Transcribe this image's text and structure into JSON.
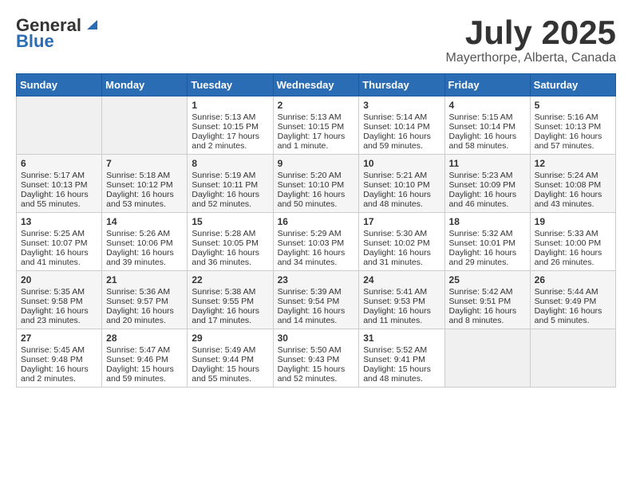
{
  "logo": {
    "general": "General",
    "blue": "Blue"
  },
  "title": "July 2025",
  "location": "Mayerthorpe, Alberta, Canada",
  "weekdays": [
    "Sunday",
    "Monday",
    "Tuesday",
    "Wednesday",
    "Thursday",
    "Friday",
    "Saturday"
  ],
  "weeks": [
    [
      {
        "day": "",
        "empty": true
      },
      {
        "day": "",
        "empty": true
      },
      {
        "day": "1",
        "sunrise": "Sunrise: 5:13 AM",
        "sunset": "Sunset: 10:15 PM",
        "daylight": "Daylight: 17 hours and 2 minutes."
      },
      {
        "day": "2",
        "sunrise": "Sunrise: 5:13 AM",
        "sunset": "Sunset: 10:15 PM",
        "daylight": "Daylight: 17 hours and 1 minute."
      },
      {
        "day": "3",
        "sunrise": "Sunrise: 5:14 AM",
        "sunset": "Sunset: 10:14 PM",
        "daylight": "Daylight: 16 hours and 59 minutes."
      },
      {
        "day": "4",
        "sunrise": "Sunrise: 5:15 AM",
        "sunset": "Sunset: 10:14 PM",
        "daylight": "Daylight: 16 hours and 58 minutes."
      },
      {
        "day": "5",
        "sunrise": "Sunrise: 5:16 AM",
        "sunset": "Sunset: 10:13 PM",
        "daylight": "Daylight: 16 hours and 57 minutes."
      }
    ],
    [
      {
        "day": "6",
        "sunrise": "Sunrise: 5:17 AM",
        "sunset": "Sunset: 10:13 PM",
        "daylight": "Daylight: 16 hours and 55 minutes."
      },
      {
        "day": "7",
        "sunrise": "Sunrise: 5:18 AM",
        "sunset": "Sunset: 10:12 PM",
        "daylight": "Daylight: 16 hours and 53 minutes."
      },
      {
        "day": "8",
        "sunrise": "Sunrise: 5:19 AM",
        "sunset": "Sunset: 10:11 PM",
        "daylight": "Daylight: 16 hours and 52 minutes."
      },
      {
        "day": "9",
        "sunrise": "Sunrise: 5:20 AM",
        "sunset": "Sunset: 10:10 PM",
        "daylight": "Daylight: 16 hours and 50 minutes."
      },
      {
        "day": "10",
        "sunrise": "Sunrise: 5:21 AM",
        "sunset": "Sunset: 10:10 PM",
        "daylight": "Daylight: 16 hours and 48 minutes."
      },
      {
        "day": "11",
        "sunrise": "Sunrise: 5:23 AM",
        "sunset": "Sunset: 10:09 PM",
        "daylight": "Daylight: 16 hours and 46 minutes."
      },
      {
        "day": "12",
        "sunrise": "Sunrise: 5:24 AM",
        "sunset": "Sunset: 10:08 PM",
        "daylight": "Daylight: 16 hours and 43 minutes."
      }
    ],
    [
      {
        "day": "13",
        "sunrise": "Sunrise: 5:25 AM",
        "sunset": "Sunset: 10:07 PM",
        "daylight": "Daylight: 16 hours and 41 minutes."
      },
      {
        "day": "14",
        "sunrise": "Sunrise: 5:26 AM",
        "sunset": "Sunset: 10:06 PM",
        "daylight": "Daylight: 16 hours and 39 minutes."
      },
      {
        "day": "15",
        "sunrise": "Sunrise: 5:28 AM",
        "sunset": "Sunset: 10:05 PM",
        "daylight": "Daylight: 16 hours and 36 minutes."
      },
      {
        "day": "16",
        "sunrise": "Sunrise: 5:29 AM",
        "sunset": "Sunset: 10:03 PM",
        "daylight": "Daylight: 16 hours and 34 minutes."
      },
      {
        "day": "17",
        "sunrise": "Sunrise: 5:30 AM",
        "sunset": "Sunset: 10:02 PM",
        "daylight": "Daylight: 16 hours and 31 minutes."
      },
      {
        "day": "18",
        "sunrise": "Sunrise: 5:32 AM",
        "sunset": "Sunset: 10:01 PM",
        "daylight": "Daylight: 16 hours and 29 minutes."
      },
      {
        "day": "19",
        "sunrise": "Sunrise: 5:33 AM",
        "sunset": "Sunset: 10:00 PM",
        "daylight": "Daylight: 16 hours and 26 minutes."
      }
    ],
    [
      {
        "day": "20",
        "sunrise": "Sunrise: 5:35 AM",
        "sunset": "Sunset: 9:58 PM",
        "daylight": "Daylight: 16 hours and 23 minutes."
      },
      {
        "day": "21",
        "sunrise": "Sunrise: 5:36 AM",
        "sunset": "Sunset: 9:57 PM",
        "daylight": "Daylight: 16 hours and 20 minutes."
      },
      {
        "day": "22",
        "sunrise": "Sunrise: 5:38 AM",
        "sunset": "Sunset: 9:55 PM",
        "daylight": "Daylight: 16 hours and 17 minutes."
      },
      {
        "day": "23",
        "sunrise": "Sunrise: 5:39 AM",
        "sunset": "Sunset: 9:54 PM",
        "daylight": "Daylight: 16 hours and 14 minutes."
      },
      {
        "day": "24",
        "sunrise": "Sunrise: 5:41 AM",
        "sunset": "Sunset: 9:53 PM",
        "daylight": "Daylight: 16 hours and 11 minutes."
      },
      {
        "day": "25",
        "sunrise": "Sunrise: 5:42 AM",
        "sunset": "Sunset: 9:51 PM",
        "daylight": "Daylight: 16 hours and 8 minutes."
      },
      {
        "day": "26",
        "sunrise": "Sunrise: 5:44 AM",
        "sunset": "Sunset: 9:49 PM",
        "daylight": "Daylight: 16 hours and 5 minutes."
      }
    ],
    [
      {
        "day": "27",
        "sunrise": "Sunrise: 5:45 AM",
        "sunset": "Sunset: 9:48 PM",
        "daylight": "Daylight: 16 hours and 2 minutes."
      },
      {
        "day": "28",
        "sunrise": "Sunrise: 5:47 AM",
        "sunset": "Sunset: 9:46 PM",
        "daylight": "Daylight: 15 hours and 59 minutes."
      },
      {
        "day": "29",
        "sunrise": "Sunrise: 5:49 AM",
        "sunset": "Sunset: 9:44 PM",
        "daylight": "Daylight: 15 hours and 55 minutes."
      },
      {
        "day": "30",
        "sunrise": "Sunrise: 5:50 AM",
        "sunset": "Sunset: 9:43 PM",
        "daylight": "Daylight: 15 hours and 52 minutes."
      },
      {
        "day": "31",
        "sunrise": "Sunrise: 5:52 AM",
        "sunset": "Sunset: 9:41 PM",
        "daylight": "Daylight: 15 hours and 48 minutes."
      },
      {
        "day": "",
        "empty": true
      },
      {
        "day": "",
        "empty": true
      }
    ]
  ]
}
